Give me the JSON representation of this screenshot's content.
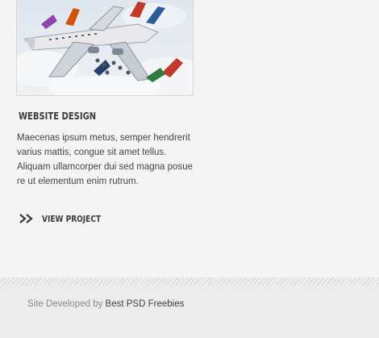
{
  "project": {
    "title": "Website Design",
    "description": "Maecenas ipsum metus, semper hendrerit varius mattis, congue sit amet tellus. Aliquam ullamcorper dui sed magna posue re ut elementum enim rutrum.",
    "view_label": "View Project",
    "thumbnail_icon": "airplane-collage-image"
  },
  "footer": {
    "prefix": "Site Developed by",
    "link_label": "Best PSD Freebies"
  }
}
